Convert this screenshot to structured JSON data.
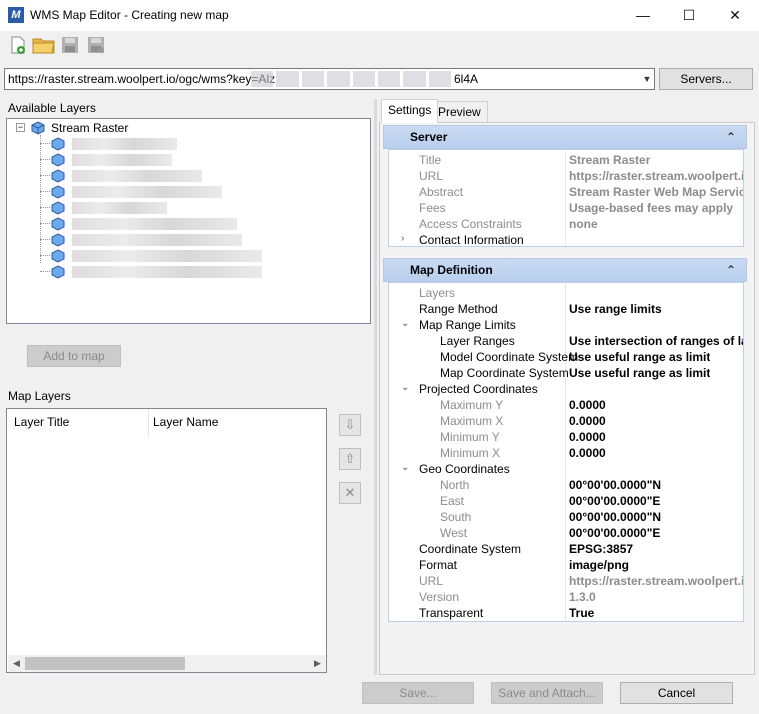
{
  "window": {
    "title": "WMS Map Editor - Creating new map",
    "app_icon_letter": "M",
    "minimize": "—",
    "maximize": "☐",
    "close": "✕"
  },
  "toolbar": {
    "new_icon": "new-file-icon",
    "open_icon": "open-folder-icon",
    "save_icon": "save-icon",
    "save_as_icon": "save-as-icon"
  },
  "url_bar": {
    "value_start": "https://raster.stream.woolpert.io/ogc/wms?key=Alz",
    "value_end": "6l4A",
    "servers_label": "Servers..."
  },
  "available_layers": {
    "title": "Available Layers",
    "root_label": "Stream Raster",
    "child_count_blurred": 9,
    "add_to_map_label": "Add to map"
  },
  "map_layers": {
    "title": "Map Layers",
    "columns": [
      "Layer Title",
      "Layer Name"
    ]
  },
  "tabs": {
    "settings": "Settings",
    "preview": "Preview"
  },
  "server_section": {
    "header": "Server",
    "rows": [
      {
        "key": "Title",
        "value": "Stream Raster"
      },
      {
        "key": "URL",
        "value": "https://raster.stream.woolpert.io"
      },
      {
        "key": "Abstract",
        "value": "Stream Raster Web Map Service"
      },
      {
        "key": "Fees",
        "value": "Usage-based fees may apply"
      },
      {
        "key": "Access Constraints",
        "value": "none"
      },
      {
        "key": "Contact Information",
        "value": ""
      }
    ]
  },
  "map_definition": {
    "header": "Map Definition",
    "rows": [
      {
        "key": "Layers",
        "value": ""
      },
      {
        "key": "Range Method",
        "value": "Use range limits"
      },
      {
        "key": "Map Range Limits",
        "value": ""
      },
      {
        "key": "Layer Ranges",
        "value": "Use intersection of ranges of layers"
      },
      {
        "key": "Model Coordinate System",
        "value": "Use useful range as limit"
      },
      {
        "key": "Map Coordinate System",
        "value": "Use useful range as limit"
      },
      {
        "key": "Projected Coordinates",
        "value": ""
      },
      {
        "key": "Maximum Y",
        "value": "0.0000"
      },
      {
        "key": "Maximum X",
        "value": "0.0000"
      },
      {
        "key": "Minimum Y",
        "value": "0.0000"
      },
      {
        "key": "Minimum X",
        "value": "0.0000"
      },
      {
        "key": "Geo Coordinates",
        "value": ""
      },
      {
        "key": "North",
        "value": "00°00'00.0000\"N"
      },
      {
        "key": "East",
        "value": "00°00'00.0000\"E"
      },
      {
        "key": "South",
        "value": "00°00'00.0000\"N"
      },
      {
        "key": "West",
        "value": "00°00'00.0000\"E"
      },
      {
        "key": "Coordinate System",
        "value": "EPSG:3857"
      },
      {
        "key": "Format",
        "value": "image/png"
      },
      {
        "key": "URL",
        "value": "https://raster.stream.woolpert.io"
      },
      {
        "key": "Version",
        "value": "1.3.0"
      },
      {
        "key": "Transparent",
        "value": "True"
      }
    ]
  },
  "footer": {
    "save": "Save...",
    "save_attach": "Save and Attach...",
    "cancel": "Cancel"
  }
}
